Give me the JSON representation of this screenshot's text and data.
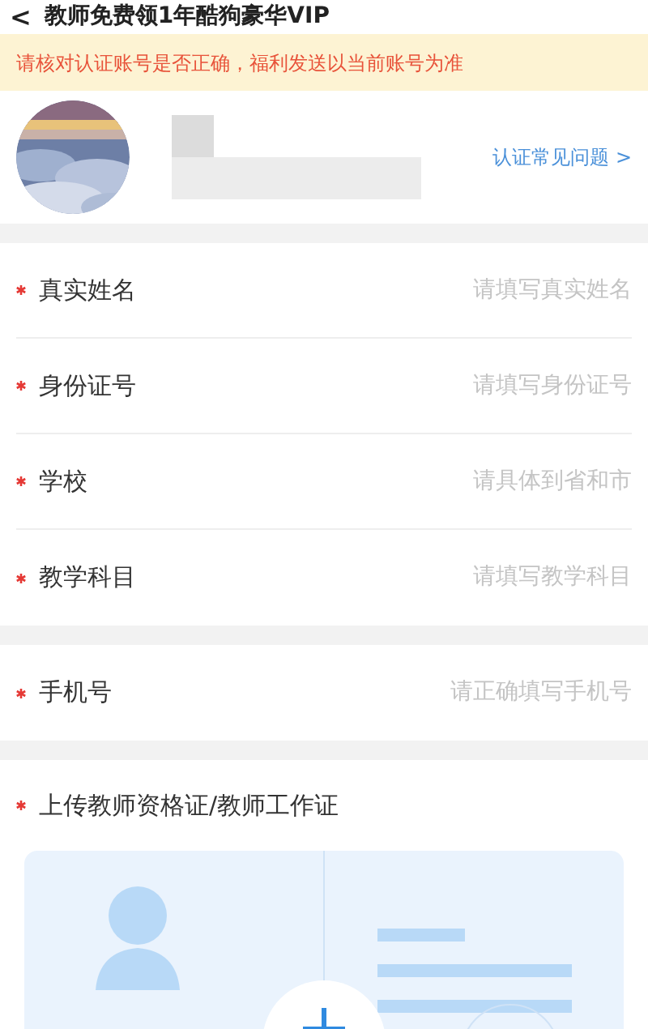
{
  "header": {
    "back": "<",
    "title": "教师免费领1年酷狗豪华VIP"
  },
  "notice": "请核对认证账号是否正确，福利发送以当前账号为准",
  "profile": {
    "faq_link": "认证常见问题",
    "faq_arrow": ">"
  },
  "form_groups": [
    [
      {
        "required": true,
        "label": "真实姓名",
        "placeholder": "请填写真实姓名"
      },
      {
        "required": true,
        "label": "身份证号",
        "placeholder": "请填写身份证号"
      },
      {
        "required": true,
        "label": "学校",
        "placeholder": "请具体到省和市"
      },
      {
        "required": true,
        "label": "教学科目",
        "placeholder": "请填写教学科目"
      }
    ],
    [
      {
        "required": true,
        "label": "手机号",
        "placeholder": "请正确填写手机号"
      }
    ]
  ],
  "upload": {
    "required": true,
    "label": "上传教师资格证/教师工作证"
  }
}
